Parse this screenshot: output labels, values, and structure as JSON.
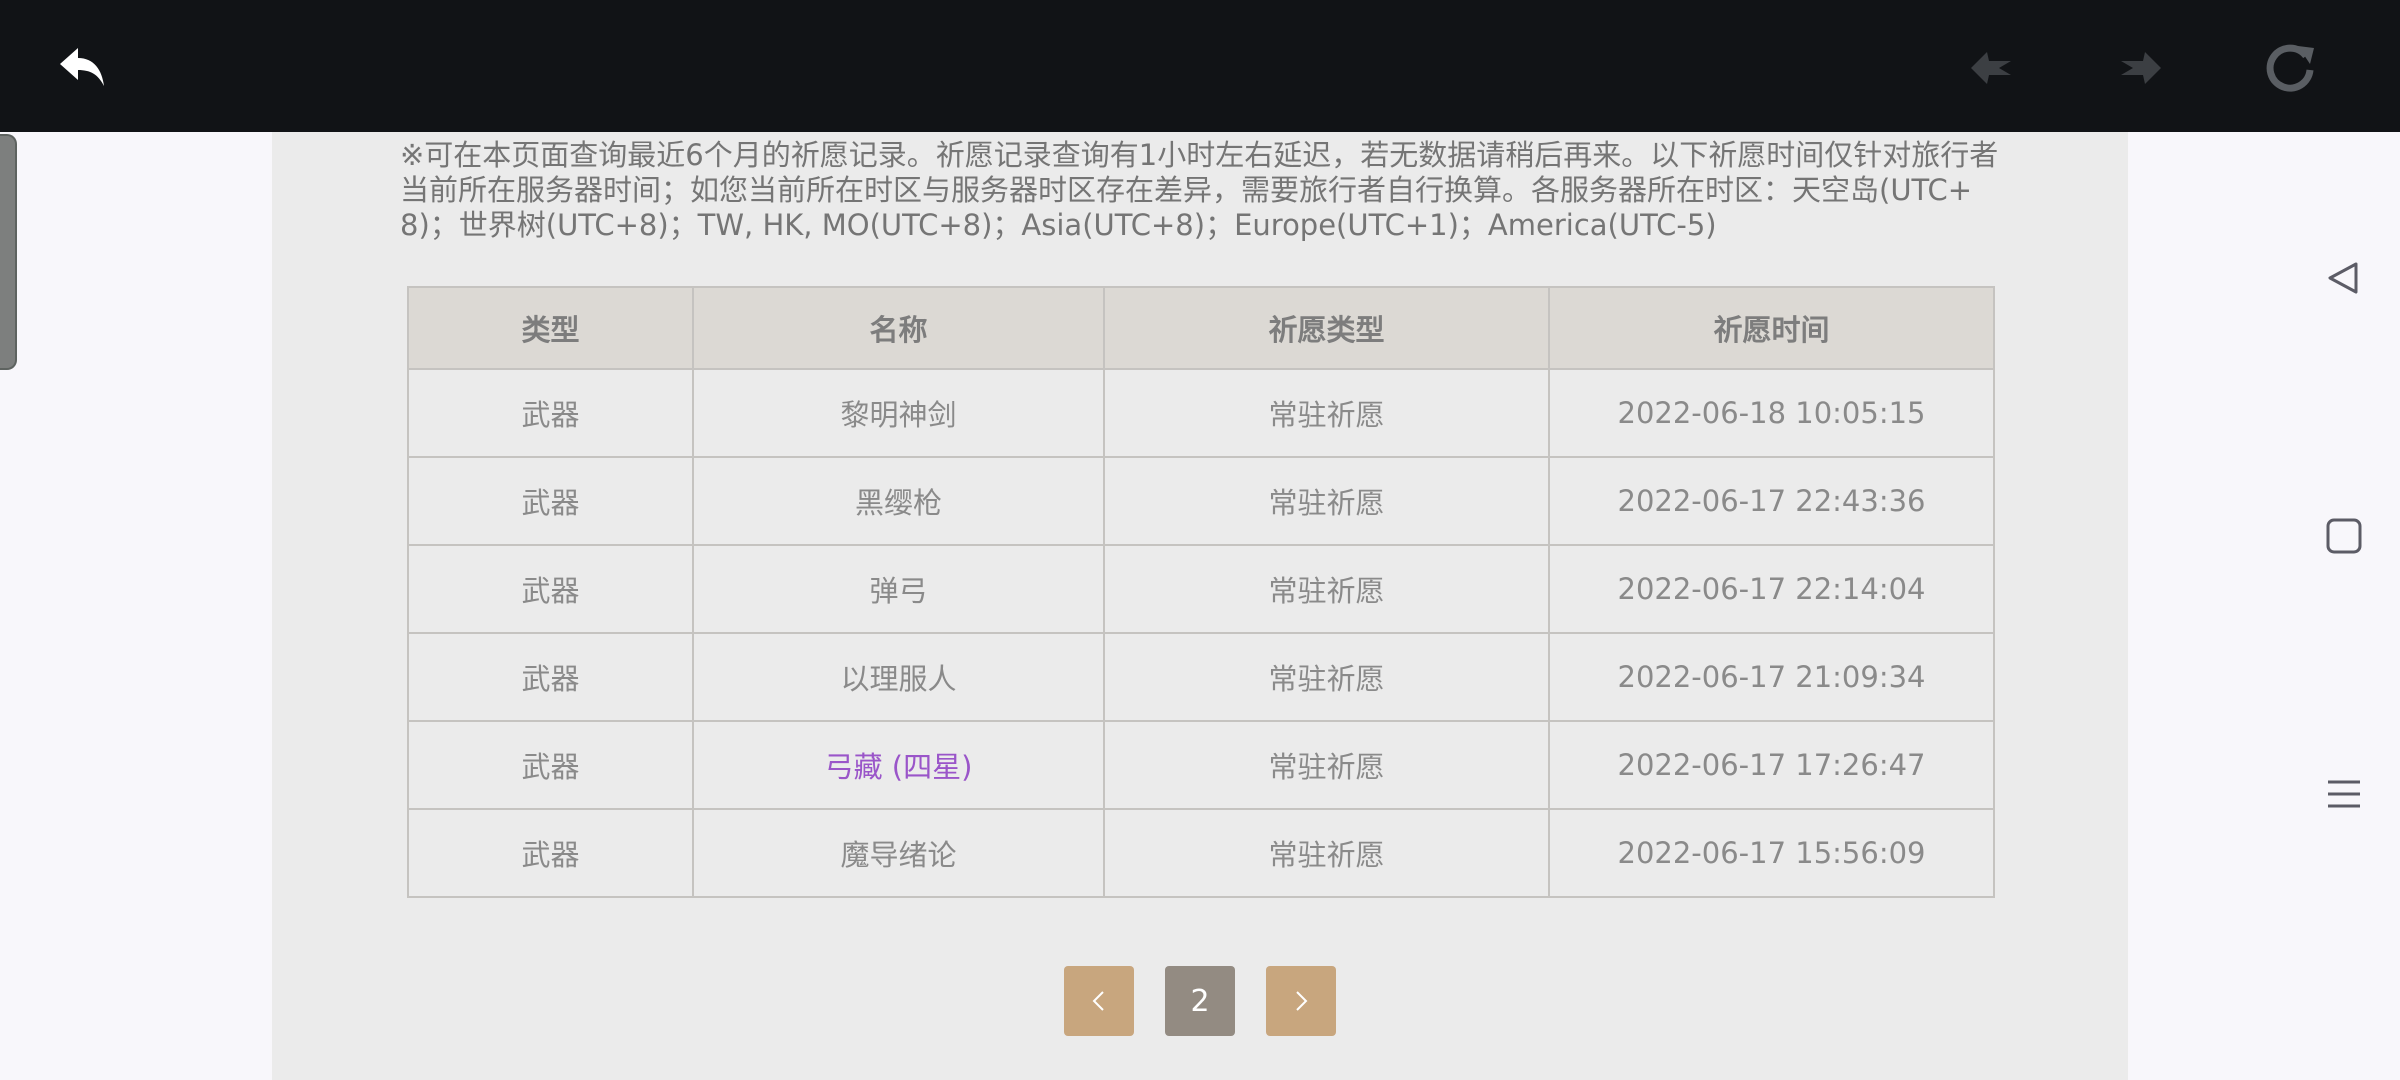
{
  "notice": "※可在本页面查询最近6个月的祈愿记录。祈愿记录查询有1小时左右延迟，若无数据请稍后再来。以下祈愿时间仅针对旅行者当前所在服务器时间；如您当前所在时区与服务器时区存在差异，需要旅行者自行换算。各服务器所在时区：天空岛(UTC+8)；世界树(UTC+8)；TW, HK, MO(UTC+8)；Asia(UTC+8)；Europe(UTC+1)；America(UTC-5)",
  "table": {
    "headers": [
      "类型",
      "名称",
      "祈愿类型",
      "祈愿时间"
    ],
    "rows": [
      {
        "type": "武器",
        "name": "黎明神剑",
        "wish_type": "常驻祈愿",
        "time": "2022-06-18 10:05:15"
      },
      {
        "type": "武器",
        "name": "黑缨枪",
        "wish_type": "常驻祈愿",
        "time": "2022-06-17 22:43:36"
      },
      {
        "type": "武器",
        "name": "弹弓",
        "wish_type": "常驻祈愿",
        "time": "2022-06-17 22:14:04"
      },
      {
        "type": "武器",
        "name": "以理服人",
        "wish_type": "常驻祈愿",
        "time": "2022-06-17 21:09:34"
      },
      {
        "type": "武器",
        "name": "弓藏 (四星)",
        "wish_type": "常驻祈愿",
        "time": "2022-06-17 17:26:47"
      },
      {
        "type": "武器",
        "name": "魔导绪论",
        "wish_type": "常驻祈愿",
        "time": "2022-06-17 15:56:09"
      }
    ]
  },
  "pagination": {
    "prev_icon": "chevron-left-icon",
    "current_page": "2",
    "next_icon": "chevron-right-icon"
  },
  "toolbar": {
    "back_icon": "back-arrow-icon",
    "nav_back_icon": "browser-back-icon",
    "nav_forward_icon": "browser-forward-icon",
    "reload_icon": "reload-icon"
  },
  "colors": {
    "topbar": "#111316",
    "panel": "#ebebeb",
    "header_bg": "#dcd9d4",
    "four_star": "#9a55c9",
    "pager_nav": "#c8a67e",
    "pager_page": "#938b82"
  }
}
